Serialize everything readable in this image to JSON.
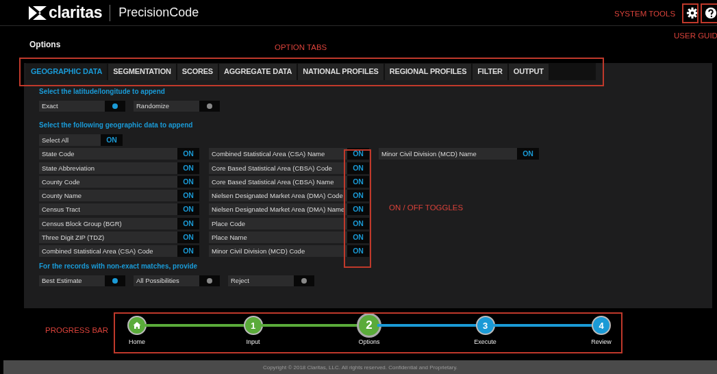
{
  "header": {
    "logo": "claritas",
    "product": "PrecisionCode"
  },
  "annotations": [
    {
      "kind": "system-tools",
      "text": "SYSTEM TOOLS"
    },
    {
      "kind": "user-guide",
      "text": "USER GUID"
    },
    {
      "kind": "option-tabs",
      "text": "OPTION TABS"
    },
    {
      "kind": "toggles",
      "text": "ON / OFF TOGGLES"
    },
    {
      "kind": "progress",
      "text": "PROGRESS BAR"
    }
  ],
  "page_title": "Options",
  "tabs": [
    {
      "label": "GEOGRAPHIC DATA",
      "selected": true
    },
    {
      "label": "SEGMENTATION",
      "selected": false
    },
    {
      "label": "SCORES",
      "selected": false
    },
    {
      "label": "AGGREGATE DATA",
      "selected": false
    },
    {
      "label": "NATIONAL PROFILES",
      "selected": false
    },
    {
      "label": "REGIONAL PROFILES",
      "selected": false
    },
    {
      "label": "FILTER",
      "selected": false
    },
    {
      "label": "OUTPUT",
      "selected": false
    }
  ],
  "latlong": {
    "heading": "Select the latitude/longitude to append",
    "options": [
      {
        "label": "Exact",
        "selected": true
      },
      {
        "label": "Randomize",
        "selected": false
      }
    ]
  },
  "geo": {
    "heading": "Select the following geographic data to append",
    "select_all": {
      "label": "Select All",
      "toggle": "ON",
      "on": true
    },
    "columns": [
      [
        {
          "label": "State Code",
          "toggle": "ON",
          "on": true
        },
        {
          "label": "State Abbreviation",
          "toggle": "ON",
          "on": true
        },
        {
          "label": "County Code",
          "toggle": "ON",
          "on": true
        },
        {
          "label": "County Name",
          "toggle": "ON",
          "on": true
        },
        {
          "label": "Census Tract",
          "toggle": "ON",
          "on": true
        },
        {
          "label": "Census Block Group (BGR)",
          "toggle": "ON",
          "on": true
        },
        {
          "label": "Three Digit ZIP (TDZ)",
          "toggle": "ON",
          "on": true
        },
        {
          "label": "Combined Statistical Area (CSA) Code",
          "toggle": "ON",
          "on": true
        }
      ],
      [
        {
          "label": "Combined Statistical Area (CSA) Name",
          "toggle": "ON",
          "on": true
        },
        {
          "label": "Core Based Statistical Area (CBSA) Code",
          "toggle": "ON",
          "on": true
        },
        {
          "label": "Core Based Statistical Area (CBSA) Name",
          "toggle": "ON",
          "on": true
        },
        {
          "label": "Nielsen Designated Market Area (DMA) Code",
          "toggle": "ON",
          "on": true
        },
        {
          "label": "Nielsen Designated Market Area (DMA) Name",
          "toggle": "ON",
          "on": true
        },
        {
          "label": "Place Code",
          "toggle": "ON",
          "on": true
        },
        {
          "label": "Place Name",
          "toggle": "ON",
          "on": true
        },
        {
          "label": "Minor Civil Division (MCD) Code",
          "toggle": "ON",
          "on": true
        }
      ],
      [
        {
          "label": "Minor Civil Division (MCD) Name",
          "toggle": "ON",
          "on": true
        }
      ]
    ]
  },
  "non_exact": {
    "heading": "For the records with non-exact matches, provide",
    "options": [
      {
        "label": "Best Estimate",
        "selected": true
      },
      {
        "label": "All Possibilities",
        "selected": false
      },
      {
        "label": "Reject",
        "selected": false
      }
    ]
  },
  "progress": [
    {
      "kind": "home",
      "label": "Home",
      "done": true,
      "selected": false
    },
    {
      "kind": "number",
      "number": "1",
      "label": "Input",
      "done": true,
      "selected": false
    },
    {
      "kind": "number",
      "number": "2",
      "label": "Options",
      "done": false,
      "selected": true
    },
    {
      "kind": "number",
      "number": "3",
      "label": "Execute",
      "done": false,
      "selected": false
    },
    {
      "kind": "number",
      "number": "4",
      "label": "Review",
      "done": false,
      "selected": false
    }
  ],
  "footer": "Copyright © 2018 Claritas, LLC. All rights reserved. Confidential and Proprietary."
}
